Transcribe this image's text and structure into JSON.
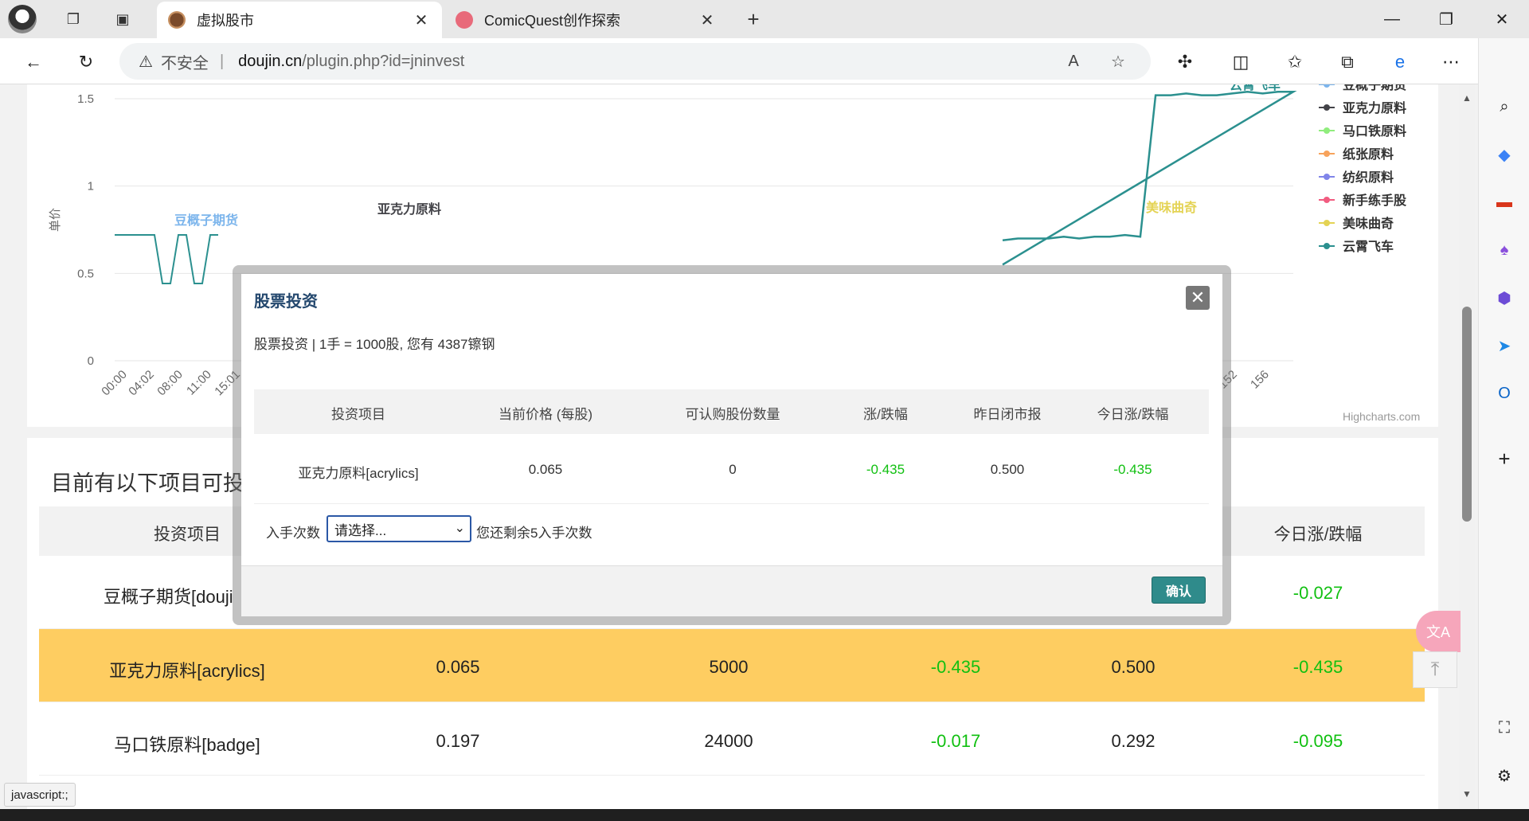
{
  "browser": {
    "tabs": [
      {
        "title": "虚拟股市",
        "active": true
      },
      {
        "title": "ComicQuest创作探索",
        "active": false
      }
    ],
    "address": {
      "security_label": "不安全",
      "host": "doujin.cn",
      "path": "/plugin.php?id=jninvest"
    },
    "status_url": "javascript:;"
  },
  "chart_data": {
    "type": "line",
    "ylabel": "单价",
    "ylim": [
      0,
      1.5
    ],
    "y_ticks": [
      "0",
      "0.5",
      "1",
      "1.5"
    ],
    "x_ticks_visible": [
      "00:00",
      "04:02",
      "08:00",
      "11:00",
      "15:01",
      "152",
      "156"
    ],
    "legend_position": "right",
    "credit": "Highcharts.com",
    "legend": [
      {
        "name": "豆概子期货",
        "color": "#7cb5ec"
      },
      {
        "name": "亚克力原料",
        "color": "#434348"
      },
      {
        "name": "马口铁原料",
        "color": "#90ed7d"
      },
      {
        "name": "纸张原料",
        "color": "#f7a35c"
      },
      {
        "name": "纺织原料",
        "color": "#8085e9"
      },
      {
        "name": "新手练手股",
        "color": "#f15c80"
      },
      {
        "name": "美味曲奇",
        "color": "#e4d354"
      },
      {
        "name": "云霄飞车",
        "color": "#2b908f"
      }
    ],
    "labels_on_plot": [
      {
        "text": "豆概子期货",
        "color": "#7cb5ec"
      },
      {
        "text": "亚克力原料",
        "color": "#434348"
      },
      {
        "text": "美味曲奇",
        "color": "#e4d354"
      },
      {
        "text": "云霄飞车",
        "color": "#2b908f"
      }
    ],
    "series": [
      {
        "name": "云霄飞车",
        "values": [
          0.69,
          0.7,
          0.7,
          0.7,
          0.71,
          0.7,
          0.71,
          0.71,
          0.72,
          0.71,
          1.52,
          1.52,
          1.53,
          1.52,
          1.52,
          1.53,
          1.54,
          1.53,
          1.54,
          1.54
        ]
      }
    ]
  },
  "list": {
    "title": "目前有以下项目可投",
    "columns": [
      "投资项目",
      "今日涨/跌幅"
    ],
    "rows": [
      {
        "name": "豆概子期货[douji",
        "price": "",
        "qty": "",
        "change": "",
        "close": "",
        "today": "-0.027",
        "highlight": false
      },
      {
        "name": "亚克力原料[acrylics]",
        "price": "0.065",
        "qty": "5000",
        "change": "-0.435",
        "close": "0.500",
        "today": "-0.435",
        "highlight": true
      },
      {
        "name": "马口铁原料[badge]",
        "price": "0.197",
        "qty": "24000",
        "change": "-0.017",
        "close": "0.292",
        "today": "-0.095",
        "highlight": false
      }
    ]
  },
  "modal": {
    "title": "股票投资",
    "info": "股票投资 | 1手 = 1000股, 您有 4387镲钢",
    "columns": [
      "投资项目",
      "当前价格 (每股)",
      "可认购股份数量",
      "涨/跌幅",
      "昨日闭市报",
      "今日涨/跌幅"
    ],
    "row": {
      "name": "亚克力原料[acrylics]",
      "price": "0.065",
      "qty": "0",
      "change": "-0.435",
      "close": "0.500",
      "today": "-0.435"
    },
    "lots_label": "入手次数",
    "select_value": "请选择...",
    "remaining_text": "您还剩余5入手次数",
    "confirm_label": "确认",
    "close_label": "✕"
  },
  "floating": {
    "translate_label": "文A",
    "to_top_label": "⤒"
  }
}
